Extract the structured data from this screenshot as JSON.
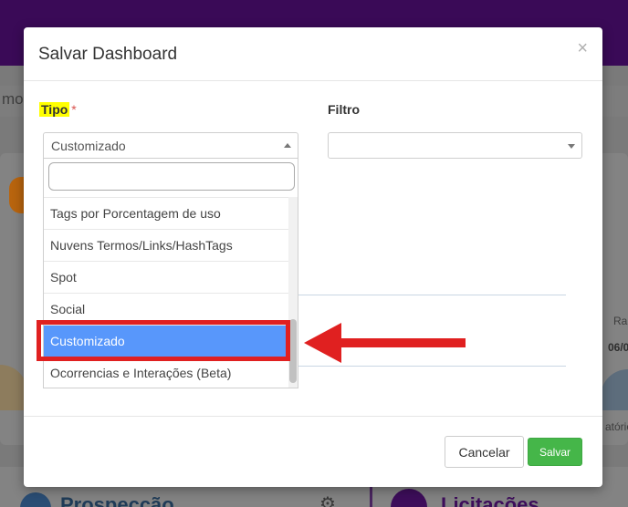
{
  "background": {
    "fragment_text": "mo",
    "ra_text": "Ra",
    "date_text": "06/0",
    "torio_text": "atório",
    "prospeccao_text": "Prospecção",
    "licitacoes_text": "Licitações",
    "gear_icon": "gear-icon"
  },
  "modal": {
    "title": "Salvar Dashboard",
    "close_symbol": "×",
    "tipo_label": "Tipo",
    "required_mark": "*",
    "filtro_label": "Filtro",
    "tipo_selected": "Customizado",
    "filtro_selected": "",
    "search_value": "",
    "options": [
      "Tags por Porcentagem de uso",
      "Nuvens Termos/Links/HashTags",
      "Spot",
      "Social",
      "Customizado",
      "Ocorrencias e Interações (Beta)"
    ],
    "selected_index": 4,
    "cancel_label": "Cancelar",
    "save_label": "Salvar"
  },
  "colors": {
    "highlight_yellow": "#ffff00",
    "annotation_red": "#e02020",
    "selected_blue": "#5897fb",
    "save_green": "#45b649",
    "header_purple": "#3a0a57"
  }
}
